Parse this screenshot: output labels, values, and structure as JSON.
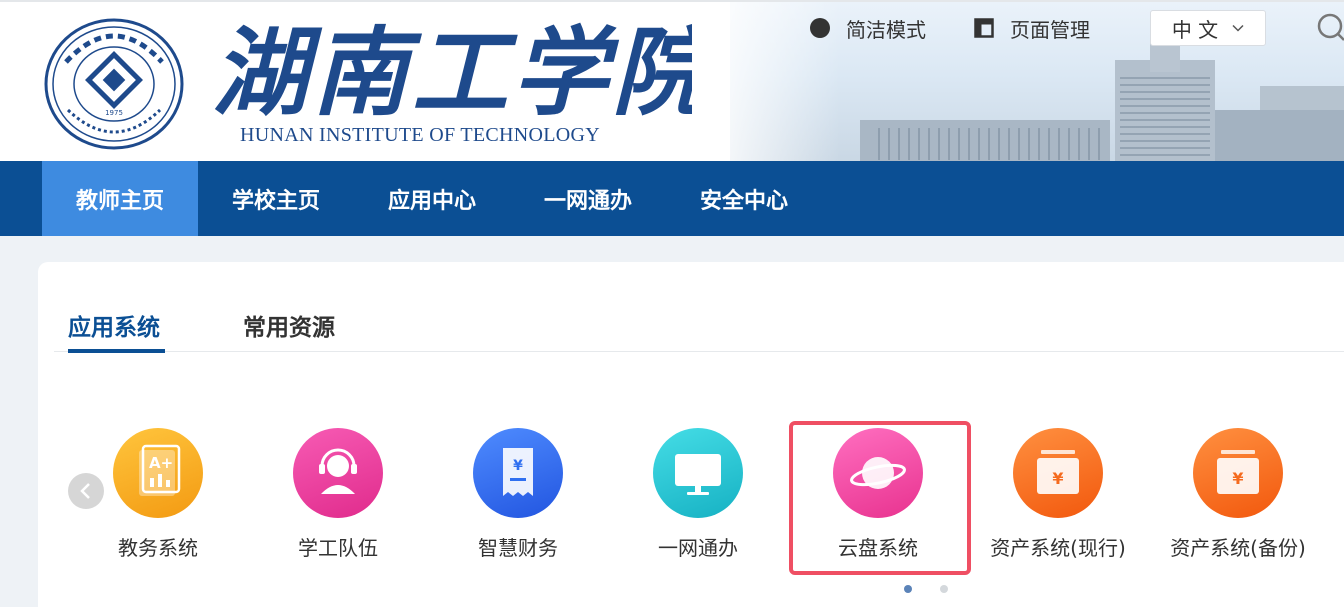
{
  "header": {
    "school_name_cn": "湖南工学院",
    "school_name_en": "HUNAN INSTITUTE OF TECHNOLOGY",
    "seal_year": "1975",
    "tools": [
      {
        "label": "简洁模式",
        "icon": "circle-dot-icon"
      },
      {
        "label": "页面管理",
        "icon": "window-icon"
      }
    ],
    "language": {
      "selected": "中 文",
      "icon": "chevron-down-icon"
    },
    "search_icon": "search-icon"
  },
  "nav": {
    "items": [
      {
        "label": "教师主页",
        "active": true
      },
      {
        "label": "学校主页",
        "active": false
      },
      {
        "label": "应用中心",
        "active": false
      },
      {
        "label": "一网通办",
        "active": false
      },
      {
        "label": "安全中心",
        "active": false
      }
    ]
  },
  "content": {
    "tabs": [
      {
        "label": "应用系统",
        "active": true
      },
      {
        "label": "常用资源",
        "active": false
      }
    ],
    "apps": [
      {
        "label": "教务系统",
        "icon": "grades-document-icon",
        "color": "#f6a21c"
      },
      {
        "label": "学工队伍",
        "icon": "headset-user-icon",
        "color": "#ec3a9a"
      },
      {
        "label": "智慧财务",
        "icon": "receipt-yuan-icon",
        "color": "#2f6ff0"
      },
      {
        "label": "一网通办",
        "icon": "monitor-icon",
        "color": "#22c4cf"
      },
      {
        "label": "云盘系统",
        "icon": "planet-icon",
        "color": "#f04aa6",
        "highlighted": true
      },
      {
        "label": "资产系统(现行)",
        "icon": "asset-yuan-icon",
        "color": "#f56a1e"
      },
      {
        "label": "资产系统(备份)",
        "icon": "asset-yuan-icon",
        "color": "#f56a1e"
      }
    ],
    "pagination": {
      "pages": 2,
      "current": 1
    }
  },
  "colors": {
    "nav_bg": "#0b4f94",
    "nav_active": "#3e8be0",
    "highlight_border": "#ef4f63"
  }
}
